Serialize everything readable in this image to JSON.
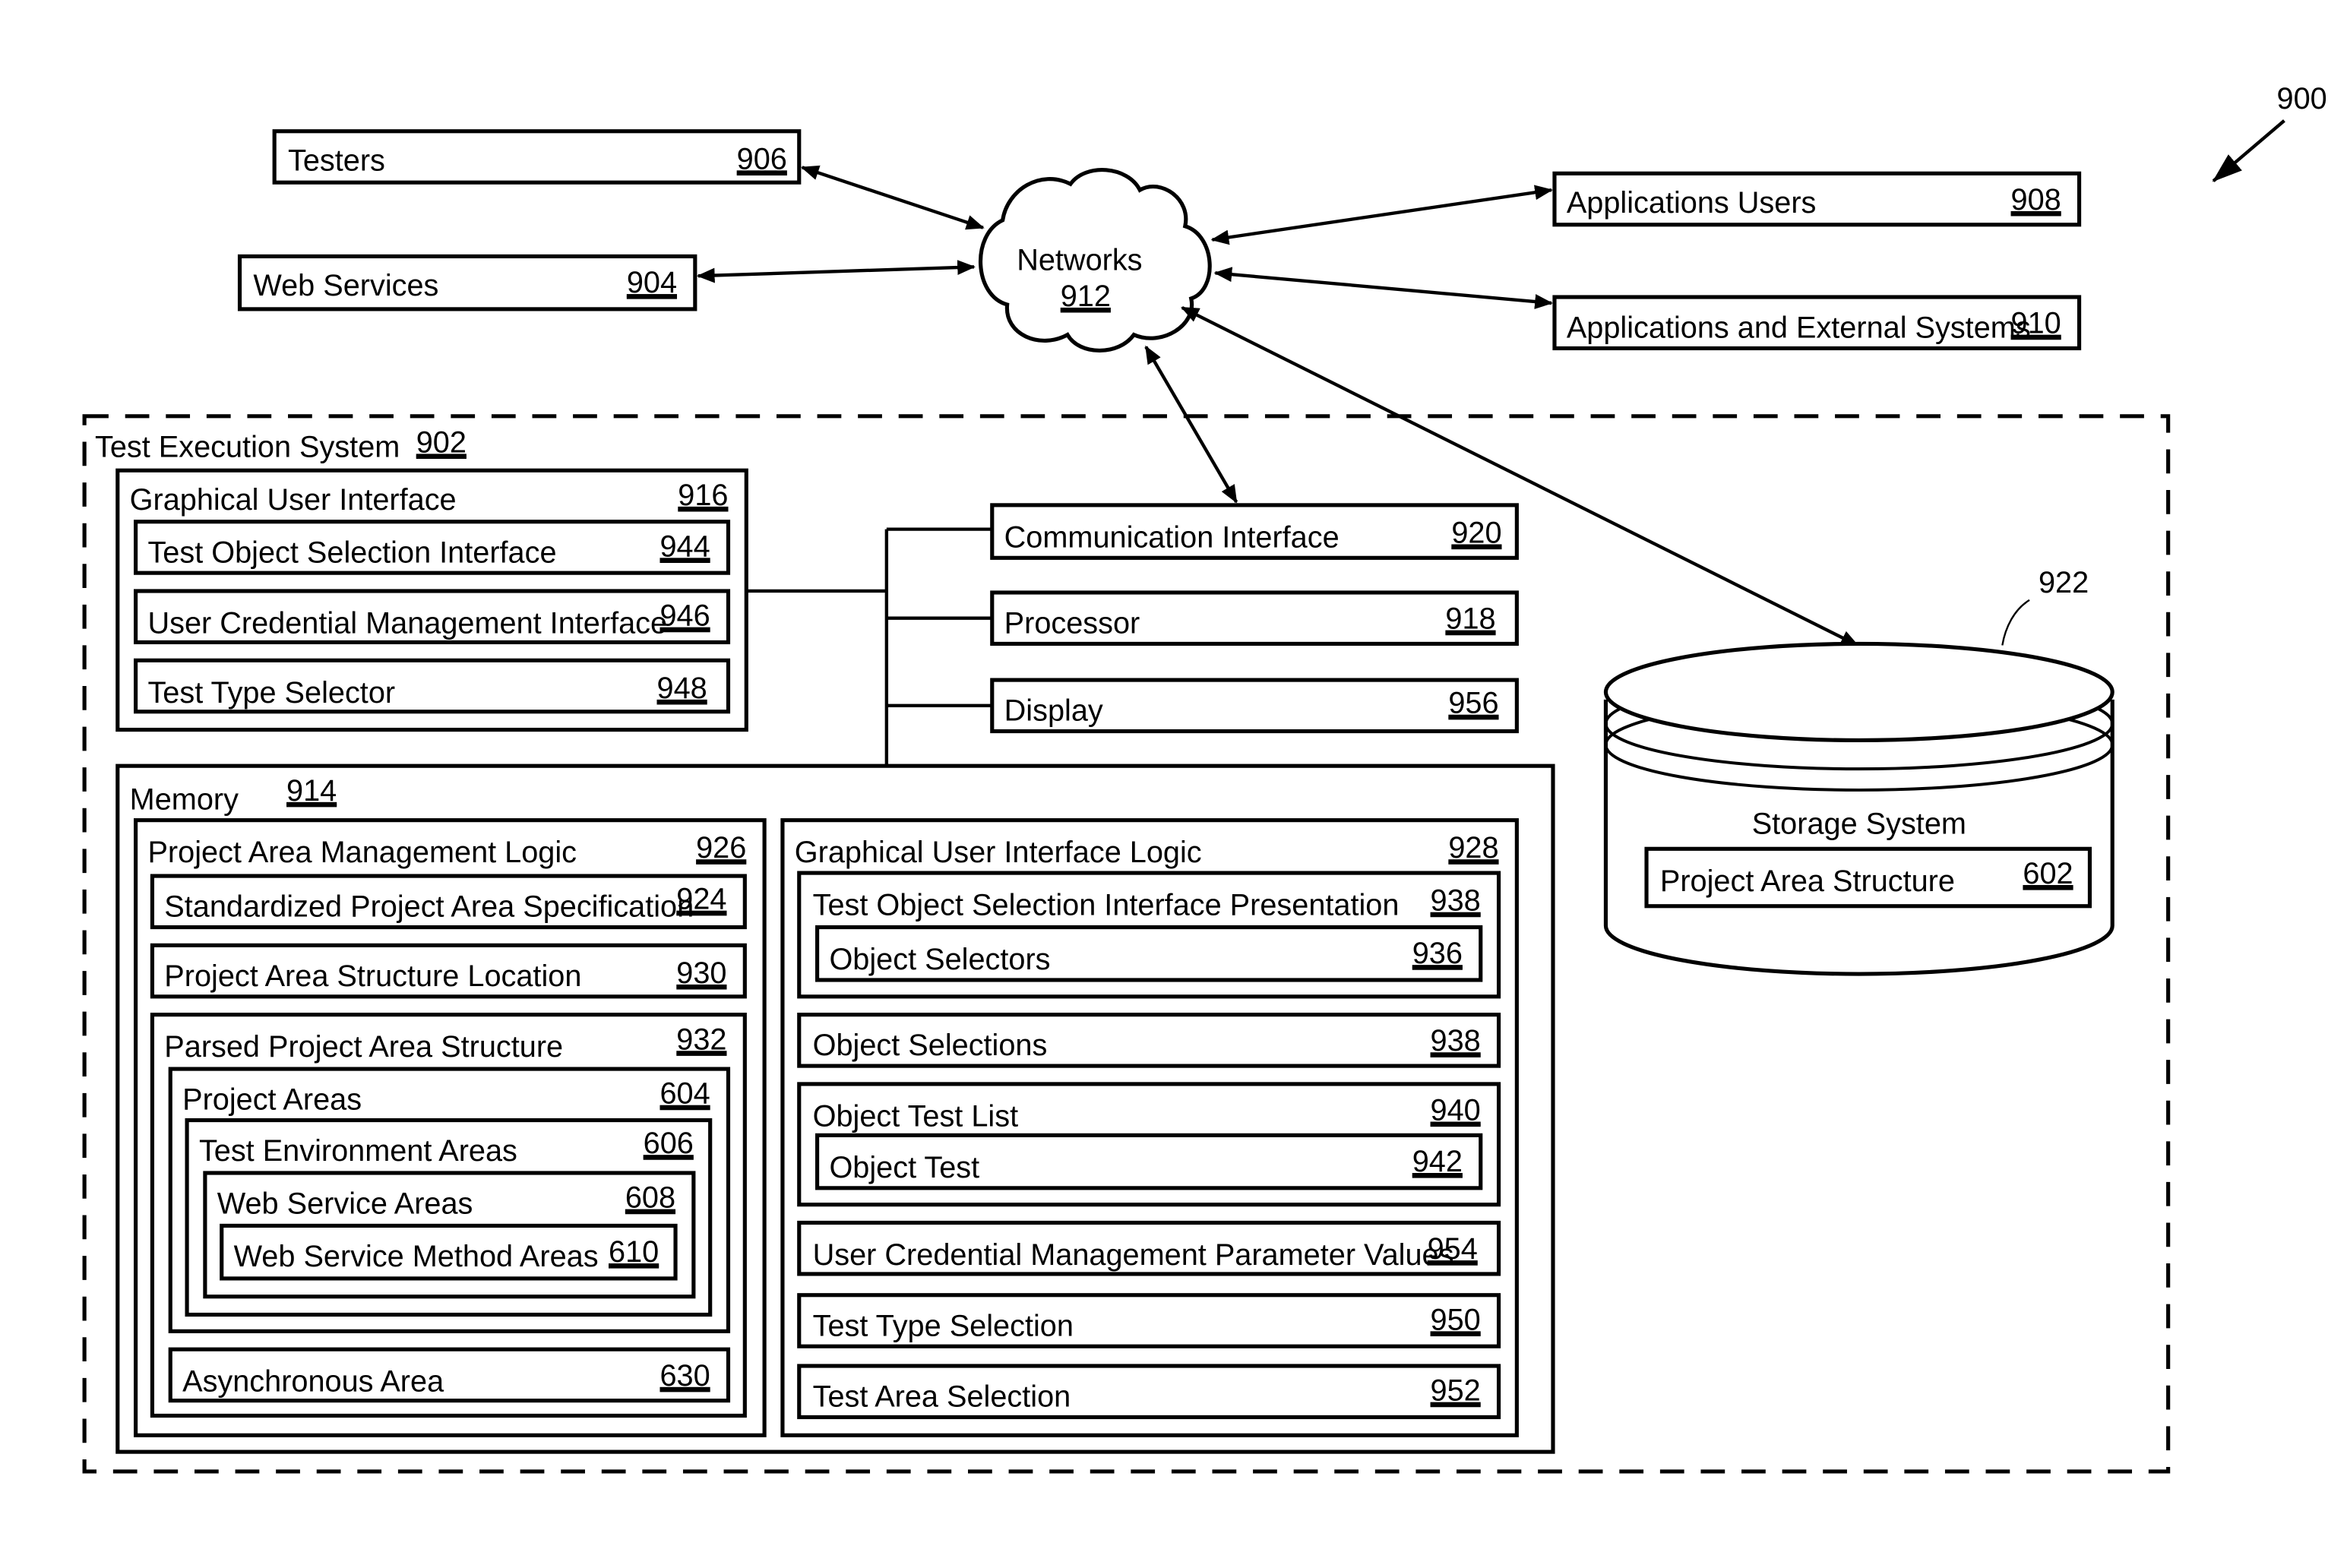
{
  "figure": {
    "reference": "900",
    "storage_reference": "922"
  },
  "external": {
    "testers": {
      "label": "Testers",
      "num": "906"
    },
    "web_services": {
      "label": "Web Services",
      "num": "904"
    },
    "networks": {
      "label": "Networks",
      "num": "912"
    },
    "app_users": {
      "label": "Applications Users",
      "num": "908"
    },
    "app_external": {
      "label": "Applications and External Systems",
      "num": "910"
    }
  },
  "system": {
    "label": "Test Execution System",
    "num": "902",
    "gui": {
      "label": "Graphical User Interface",
      "num": "916",
      "items": [
        {
          "label": "Test Object Selection Interface",
          "num": "944"
        },
        {
          "label": "User Credential Management Interface",
          "num": "946"
        },
        {
          "label": "Test Type Selector",
          "num": "948"
        }
      ]
    },
    "components": [
      {
        "label": "Communication Interface",
        "num": "920"
      },
      {
        "label": "Processor",
        "num": "918"
      },
      {
        "label": "Display",
        "num": "956"
      }
    ],
    "storage": {
      "label": "Storage System",
      "inner": {
        "label": "Project Area Structure",
        "num": "602"
      }
    },
    "memory": {
      "label": "Memory",
      "num": "914",
      "pam": {
        "label": "Project Area Management Logic",
        "num": "926",
        "spec": {
          "label": "Standardized Project Area Specification",
          "num": "924"
        },
        "location": {
          "label": "Project Area Structure Location",
          "num": "930"
        },
        "parsed": {
          "label": "Parsed Project Area Structure",
          "num": "932",
          "project_areas": {
            "label": "Project Areas",
            "num": "604"
          },
          "test_env": {
            "label": "Test Environment Areas",
            "num": "606"
          },
          "ws_areas": {
            "label": "Web Service Areas",
            "num": "608"
          },
          "ws_method": {
            "label": "Web Service Method Areas",
            "num": "610"
          },
          "async": {
            "label": "Asynchronous Area",
            "num": "630"
          }
        }
      },
      "gui_logic": {
        "label": "Graphical User Interface Logic",
        "num": "928",
        "tosip": {
          "label": "Test Object Selection Interface Presentation",
          "num": "938"
        },
        "selectors": {
          "label": "Object Selectors",
          "num": "936"
        },
        "selections": {
          "label": "Object Selections",
          "num": "938"
        },
        "test_list": {
          "label": "Object Test List",
          "num": "940"
        },
        "object_test": {
          "label": "Object Test",
          "num": "942"
        },
        "credential_values": {
          "label": "User Credential Management Parameter Values",
          "num": "954"
        },
        "test_type": {
          "label": "Test Type Selection",
          "num": "950"
        },
        "test_area": {
          "label": "Test Area Selection",
          "num": "952"
        }
      }
    }
  }
}
